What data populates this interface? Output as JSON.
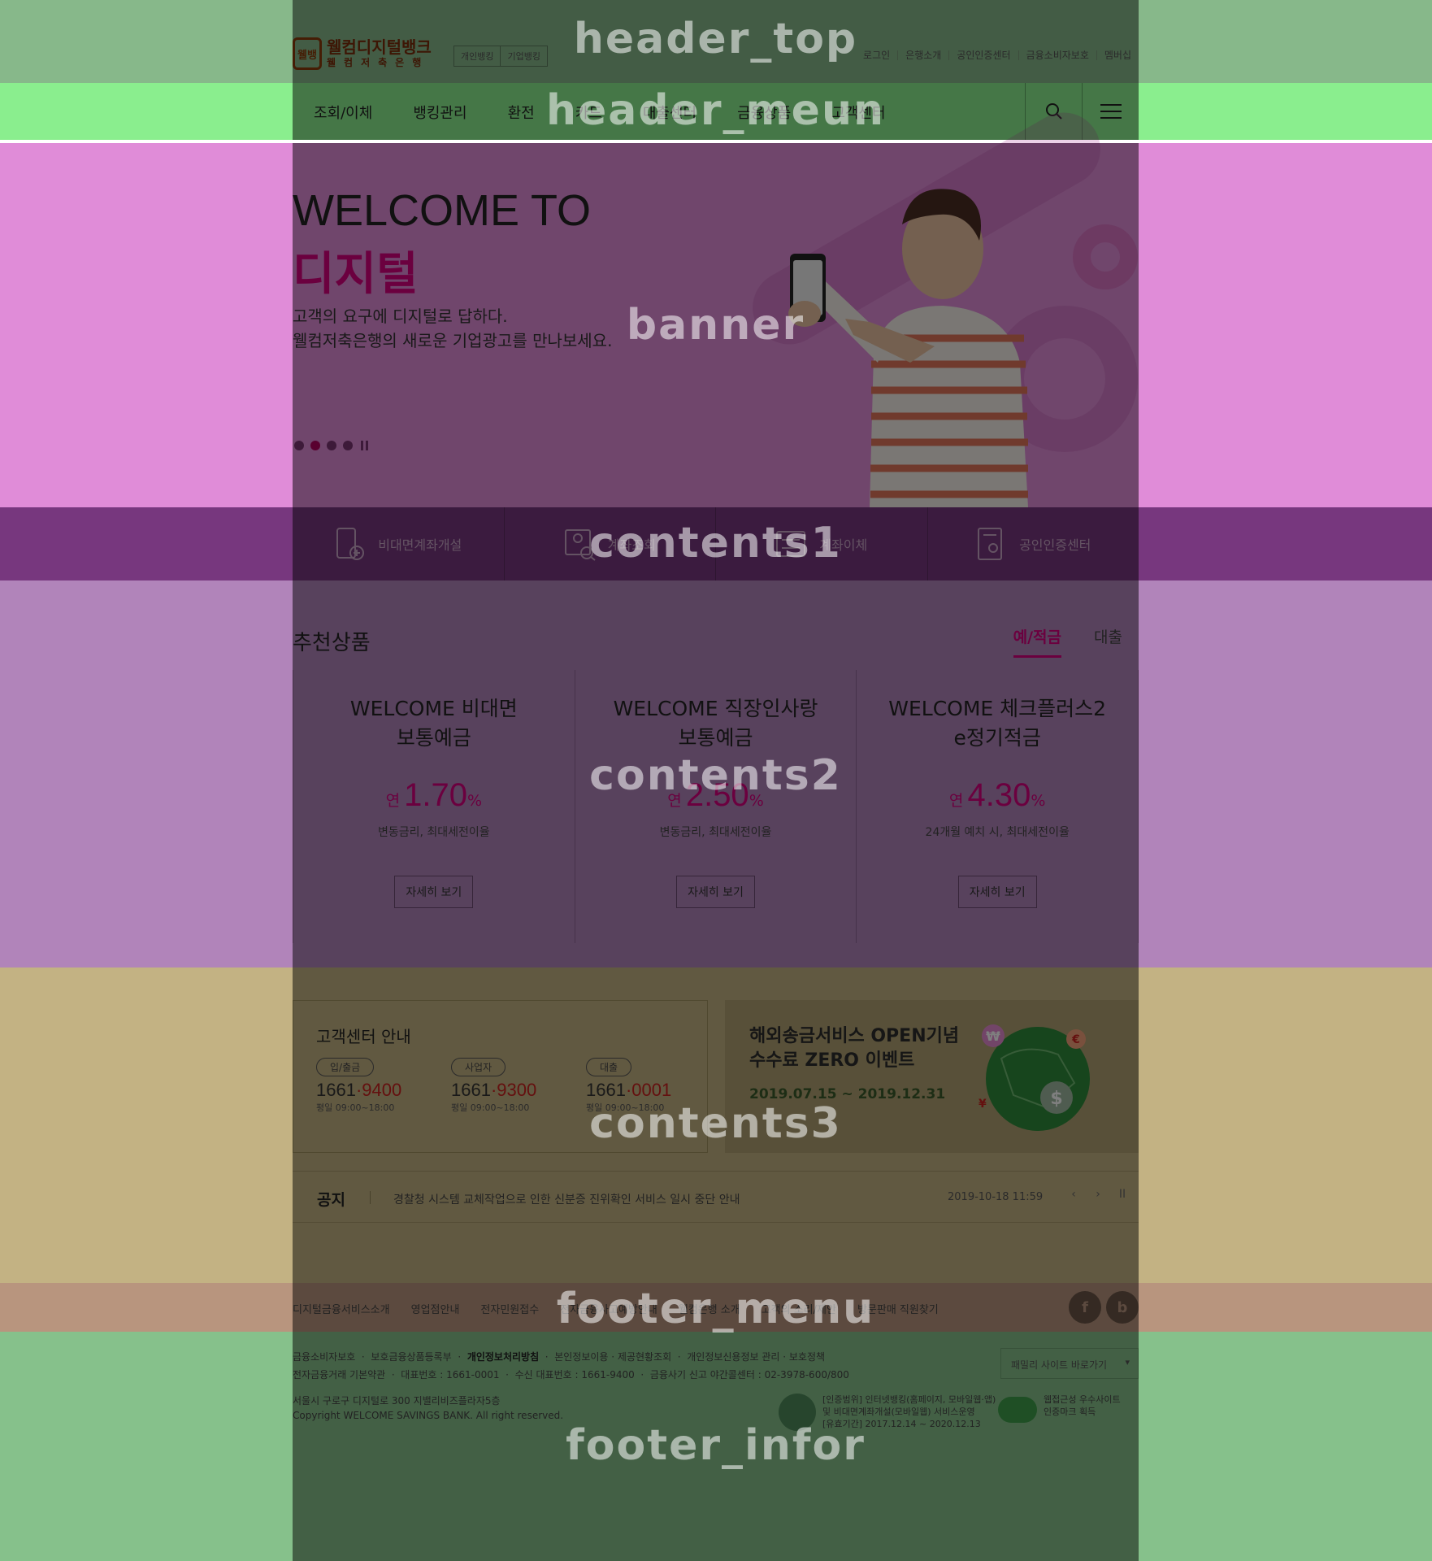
{
  "region_labels": {
    "header_top": "header_top",
    "header_menu": "header_meun",
    "banner": "banner",
    "contents1": "contents1",
    "contents2": "contents2",
    "contents3": "contents3",
    "footer_menu": "footer_menu",
    "footer_info": "footer_infor"
  },
  "header": {
    "logo_badge": "웰뱅",
    "logo_main": "웰컴디지털뱅크",
    "logo_sub": "웰컴저축은행",
    "bank_switch": [
      "개인뱅킹",
      "기업뱅킹"
    ],
    "util_links": [
      "로그인",
      "은행소개",
      "공인인증센터",
      "금융소비자보호",
      "멤버십"
    ]
  },
  "gnb": {
    "items": [
      "조회/이체",
      "뱅킹관리",
      "환전",
      "카드",
      "대출센터",
      "금융상품",
      "고객센터"
    ],
    "search_icon": "search-icon",
    "menu_icon": "hamburger-menu-icon"
  },
  "banner": {
    "line1": "WELCOME TO",
    "line2": "디지털",
    "desc1": "고객의 요구에 디지털로 답하다.",
    "desc2": "웰컴저축은행의 새로운 기업광고를 만나보세요.",
    "slide_count": 4,
    "active_slide": 2
  },
  "quick_menu": [
    {
      "label": "비대면계좌개설",
      "icon": "phone-plus-icon"
    },
    {
      "label": "계좌조회",
      "icon": "account-search-icon"
    },
    {
      "label": "계좌이체",
      "icon": "transfer-icon"
    },
    {
      "label": "공인인증센터",
      "icon": "certificate-icon"
    }
  ],
  "products": {
    "title": "추천상품",
    "tabs": [
      "예/적금",
      "대출"
    ],
    "active_tab": 0,
    "cards": [
      {
        "title1": "WELCOME 비대면",
        "title2": "보통예금",
        "rate_prefix": "연",
        "rate": "1.70",
        "rate_suffix": "%",
        "note": "변동금리, 최대세전이율",
        "button": "자세히 보기"
      },
      {
        "title1": "WELCOME 직장인사랑",
        "title2": "보통예금",
        "rate_prefix": "연",
        "rate": "2.50",
        "rate_suffix": "%",
        "note": "변동금리, 최대세전이율",
        "button": "자세히 보기"
      },
      {
        "title1": "WELCOME 체크플러스2",
        "title2": "e정기적금",
        "rate_prefix": "연",
        "rate": "4.30",
        "rate_suffix": "%",
        "note": "24개월 예치 시, 최대세전이율",
        "button": "자세히 보기"
      }
    ]
  },
  "customer_center": {
    "title": "고객센터 안내",
    "lines": [
      {
        "tag": "입/출금",
        "num_a": "1661",
        "num_b": "·9400",
        "hours": "평일 09:00~18:00"
      },
      {
        "tag": "사업자",
        "num_a": "1661",
        "num_b": "·9300",
        "hours": "평일 09:00~18:00"
      },
      {
        "tag": "대출",
        "num_a": "1661",
        "num_b": "·0001",
        "hours": "평일 09:00~18:00"
      }
    ]
  },
  "event": {
    "title1": "해외송금서비스 OPEN기념",
    "title2": "수수료 ZERO 이벤트",
    "period": "2019.07.15 ~ 2019.12.31",
    "symbols": [
      "₩",
      "€",
      "$",
      "¥"
    ]
  },
  "notice": {
    "label": "공지",
    "text": "경찰청 시스템 교체작업으로 인한 신분증 진위확인 서비스 일시 중단 안내",
    "date": "2019-10-18 11:59",
    "prev": "‹",
    "next": "›",
    "pause": "II"
  },
  "footer_menu": {
    "items": [
      "디지털금융서비스소개",
      "영업점안내",
      "전자민원접수",
      "전자금융사고예방안내",
      "웰컴은행 소개",
      "고객의 소리/제안",
      "방문판매 직원찾기"
    ],
    "sns": [
      "f",
      "b"
    ]
  },
  "footer_info": {
    "line1": [
      "금융소비자보호",
      "보호금융상품등록부",
      "개인정보처리방침",
      "본인정보이용 · 제공현황조회",
      "개인정보신용정보 관리 · 보호정책"
    ],
    "line2": [
      "전자금융거래 기본약관",
      "대표번호 : 1661-0001",
      "수신 대표번호 : 1661-9400",
      "금융사기 신고 야간콜센터 : 02-3978-600/800"
    ],
    "address": "서울시 구로구 디지털로 300 지밸리비즈플라자5층",
    "copyright": "Copyright WELCOME SAVINGS BANK. All right reserved.",
    "family_site": "패밀리 사이트 바로가기",
    "cert1": [
      "[인증범위] 인터넷뱅킹(홈페이지, 모바일웹·앱)",
      "및 비대면계좌개설(모바일웹) 서비스운영",
      "[유효기간] 2017.12.14 ~ 2020.12.13"
    ],
    "cert2": [
      "웹접근성 우수사이트",
      "인증마크 획득"
    ]
  }
}
